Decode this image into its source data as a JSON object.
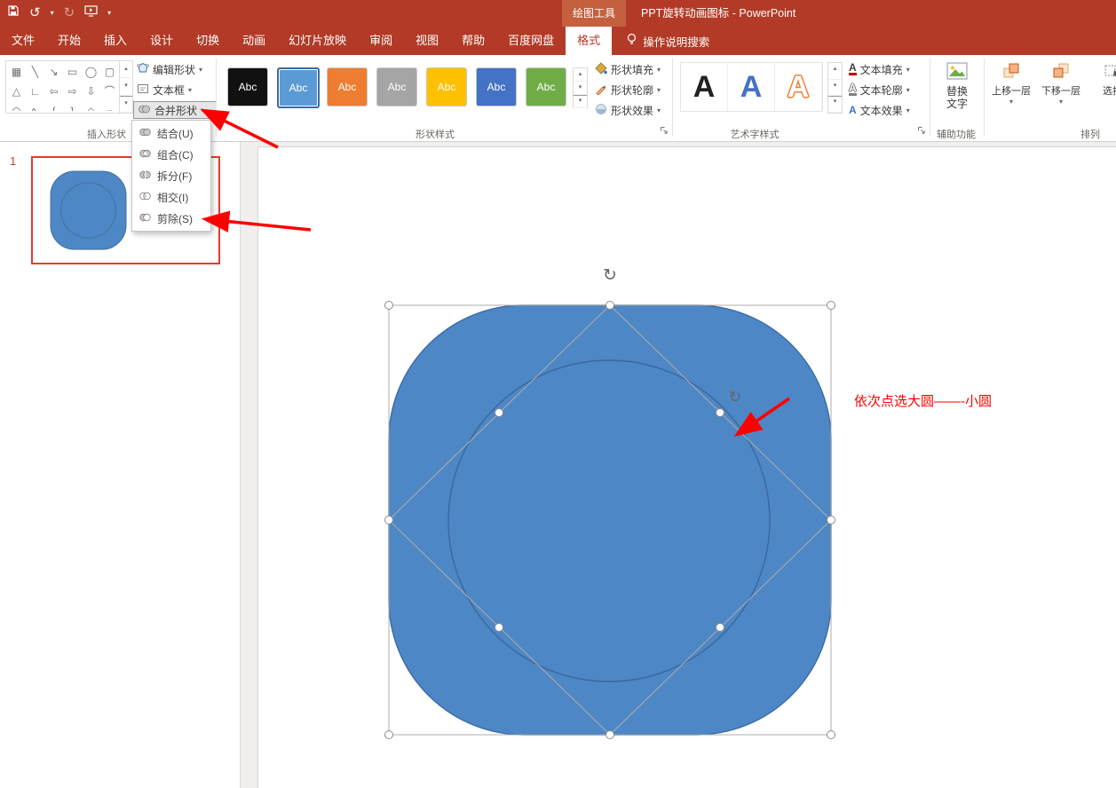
{
  "colors": {
    "brand": "#B23A26",
    "brand_light": "#C5603F",
    "accent_blue": "#4E87C5",
    "accent_blue_dark": "#41719C",
    "annotation": "#FF0000"
  },
  "titlebar": {
    "contextual_label": "绘图工具",
    "title": "PPT旋转动画图标  -  PowerPoint"
  },
  "tabs": {
    "items": [
      "文件",
      "开始",
      "插入",
      "设计",
      "切换",
      "动画",
      "幻灯片放映",
      "审阅",
      "视图",
      "帮助",
      "百度网盘",
      "格式"
    ],
    "active": "格式",
    "search_label": "操作说明搜索"
  },
  "icons": {
    "caret": "▾",
    "undo": "↺",
    "redo": "↻",
    "rotate": "↻",
    "scroll_up": "▴",
    "scroll_down": "▾",
    "letter_a": "A"
  },
  "ribbon": {
    "insert_shapes": {
      "group_label": "插入形状",
      "gallery": [
        "▦",
        "╲",
        "↘",
        "▭",
        "◯",
        "▢",
        "△",
        "∟",
        "⇦",
        "⇨",
        "⇩",
        "⌒",
        "◠",
        "∿",
        "{",
        "}",
        "◇",
        "⌐"
      ],
      "buttons": [
        {
          "label": "编辑形状"
        },
        {
          "label": "文本框"
        },
        {
          "label": "合并形状",
          "open": true
        }
      ]
    },
    "merge_menu": {
      "items": [
        {
          "label": "结合(U)"
        },
        {
          "label": "组合(C)"
        },
        {
          "label": "拆分(F)"
        },
        {
          "label": "相交(I)"
        },
        {
          "label": "剪除(S)"
        }
      ]
    },
    "shape_styles": {
      "group_label": "形状样式",
      "chips": [
        {
          "label": "Abc",
          "bg": "#111111"
        },
        {
          "label": "Abc",
          "bg": "#5B9BD5",
          "selected": true
        },
        {
          "label": "Abc",
          "bg": "#ED7D31"
        },
        {
          "label": "Abc",
          "bg": "#A5A5A5"
        },
        {
          "label": "Abc",
          "bg": "#FFC000"
        },
        {
          "label": "Abc",
          "bg": "#4472C4"
        },
        {
          "label": "Abc",
          "bg": "#70AD47"
        }
      ],
      "buttons": [
        "形状填充",
        "形状轮廓",
        "形状效果"
      ]
    },
    "wordart": {
      "group_label": "艺术字样式",
      "letters": [
        {
          "char": "A",
          "color": "#222222"
        },
        {
          "char": "A",
          "color": "#4472C4"
        },
        {
          "char": "A",
          "color": "#FFFFFF",
          "outline": "#ED7D31"
        }
      ],
      "buttons": [
        "文本填充",
        "文本轮廓",
        "文本效果"
      ]
    },
    "accessibility": {
      "group_label": "辅助功能",
      "alt_text_label": "替换文字"
    },
    "arrange": {
      "group_label": "排列",
      "buttons": [
        "上移一层",
        "下移一层",
        "选择"
      ]
    }
  },
  "slides_panel": {
    "slide_number": "1"
  },
  "annotations": {
    "note": "依次点选大圆——-小圆"
  }
}
